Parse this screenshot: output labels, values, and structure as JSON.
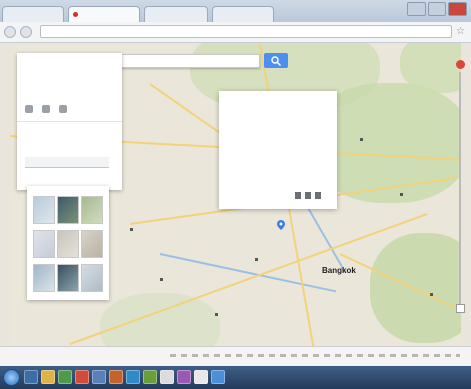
{
  "browser": {
    "tabs": [
      {
        "label": "",
        "active": false
      },
      {
        "label": "",
        "active": true
      },
      {
        "label": "",
        "active": false
      },
      {
        "label": "",
        "active": false
      }
    ],
    "address": "",
    "star_icon": "star-icon"
  },
  "search": {
    "value": "",
    "button_icon": "search-icon"
  },
  "left_panel": {
    "title": "",
    "icons": [
      "directions-icon",
      "share-icon",
      "print-icon"
    ],
    "subtitle": "",
    "link": "",
    "field": ""
  },
  "map_types": {
    "label": ""
  },
  "map": {
    "city_label": "Bangkok",
    "pin_icon": "location-pin-icon"
  },
  "info_popup": {
    "title": "",
    "rows": [
      {
        "key": "",
        "value": ""
      },
      {
        "key": "",
        "value": ""
      },
      {
        "key": "",
        "value": ""
      },
      {
        "key": "",
        "value": ""
      },
      {
        "key": "",
        "value": ""
      },
      {
        "key": "",
        "value": ""
      },
      {
        "key": "",
        "value": ""
      }
    ],
    "footer": ""
  },
  "status_bar": {
    "text": ""
  },
  "taskbar": {
    "tray": ""
  },
  "colors": {
    "accent_blue": "#4d8ff0",
    "land": "#ebe6da",
    "park": "#c9dcae",
    "road": "#f2d27a",
    "water": "#9cc0e4",
    "taskbar": "#233b5c"
  }
}
